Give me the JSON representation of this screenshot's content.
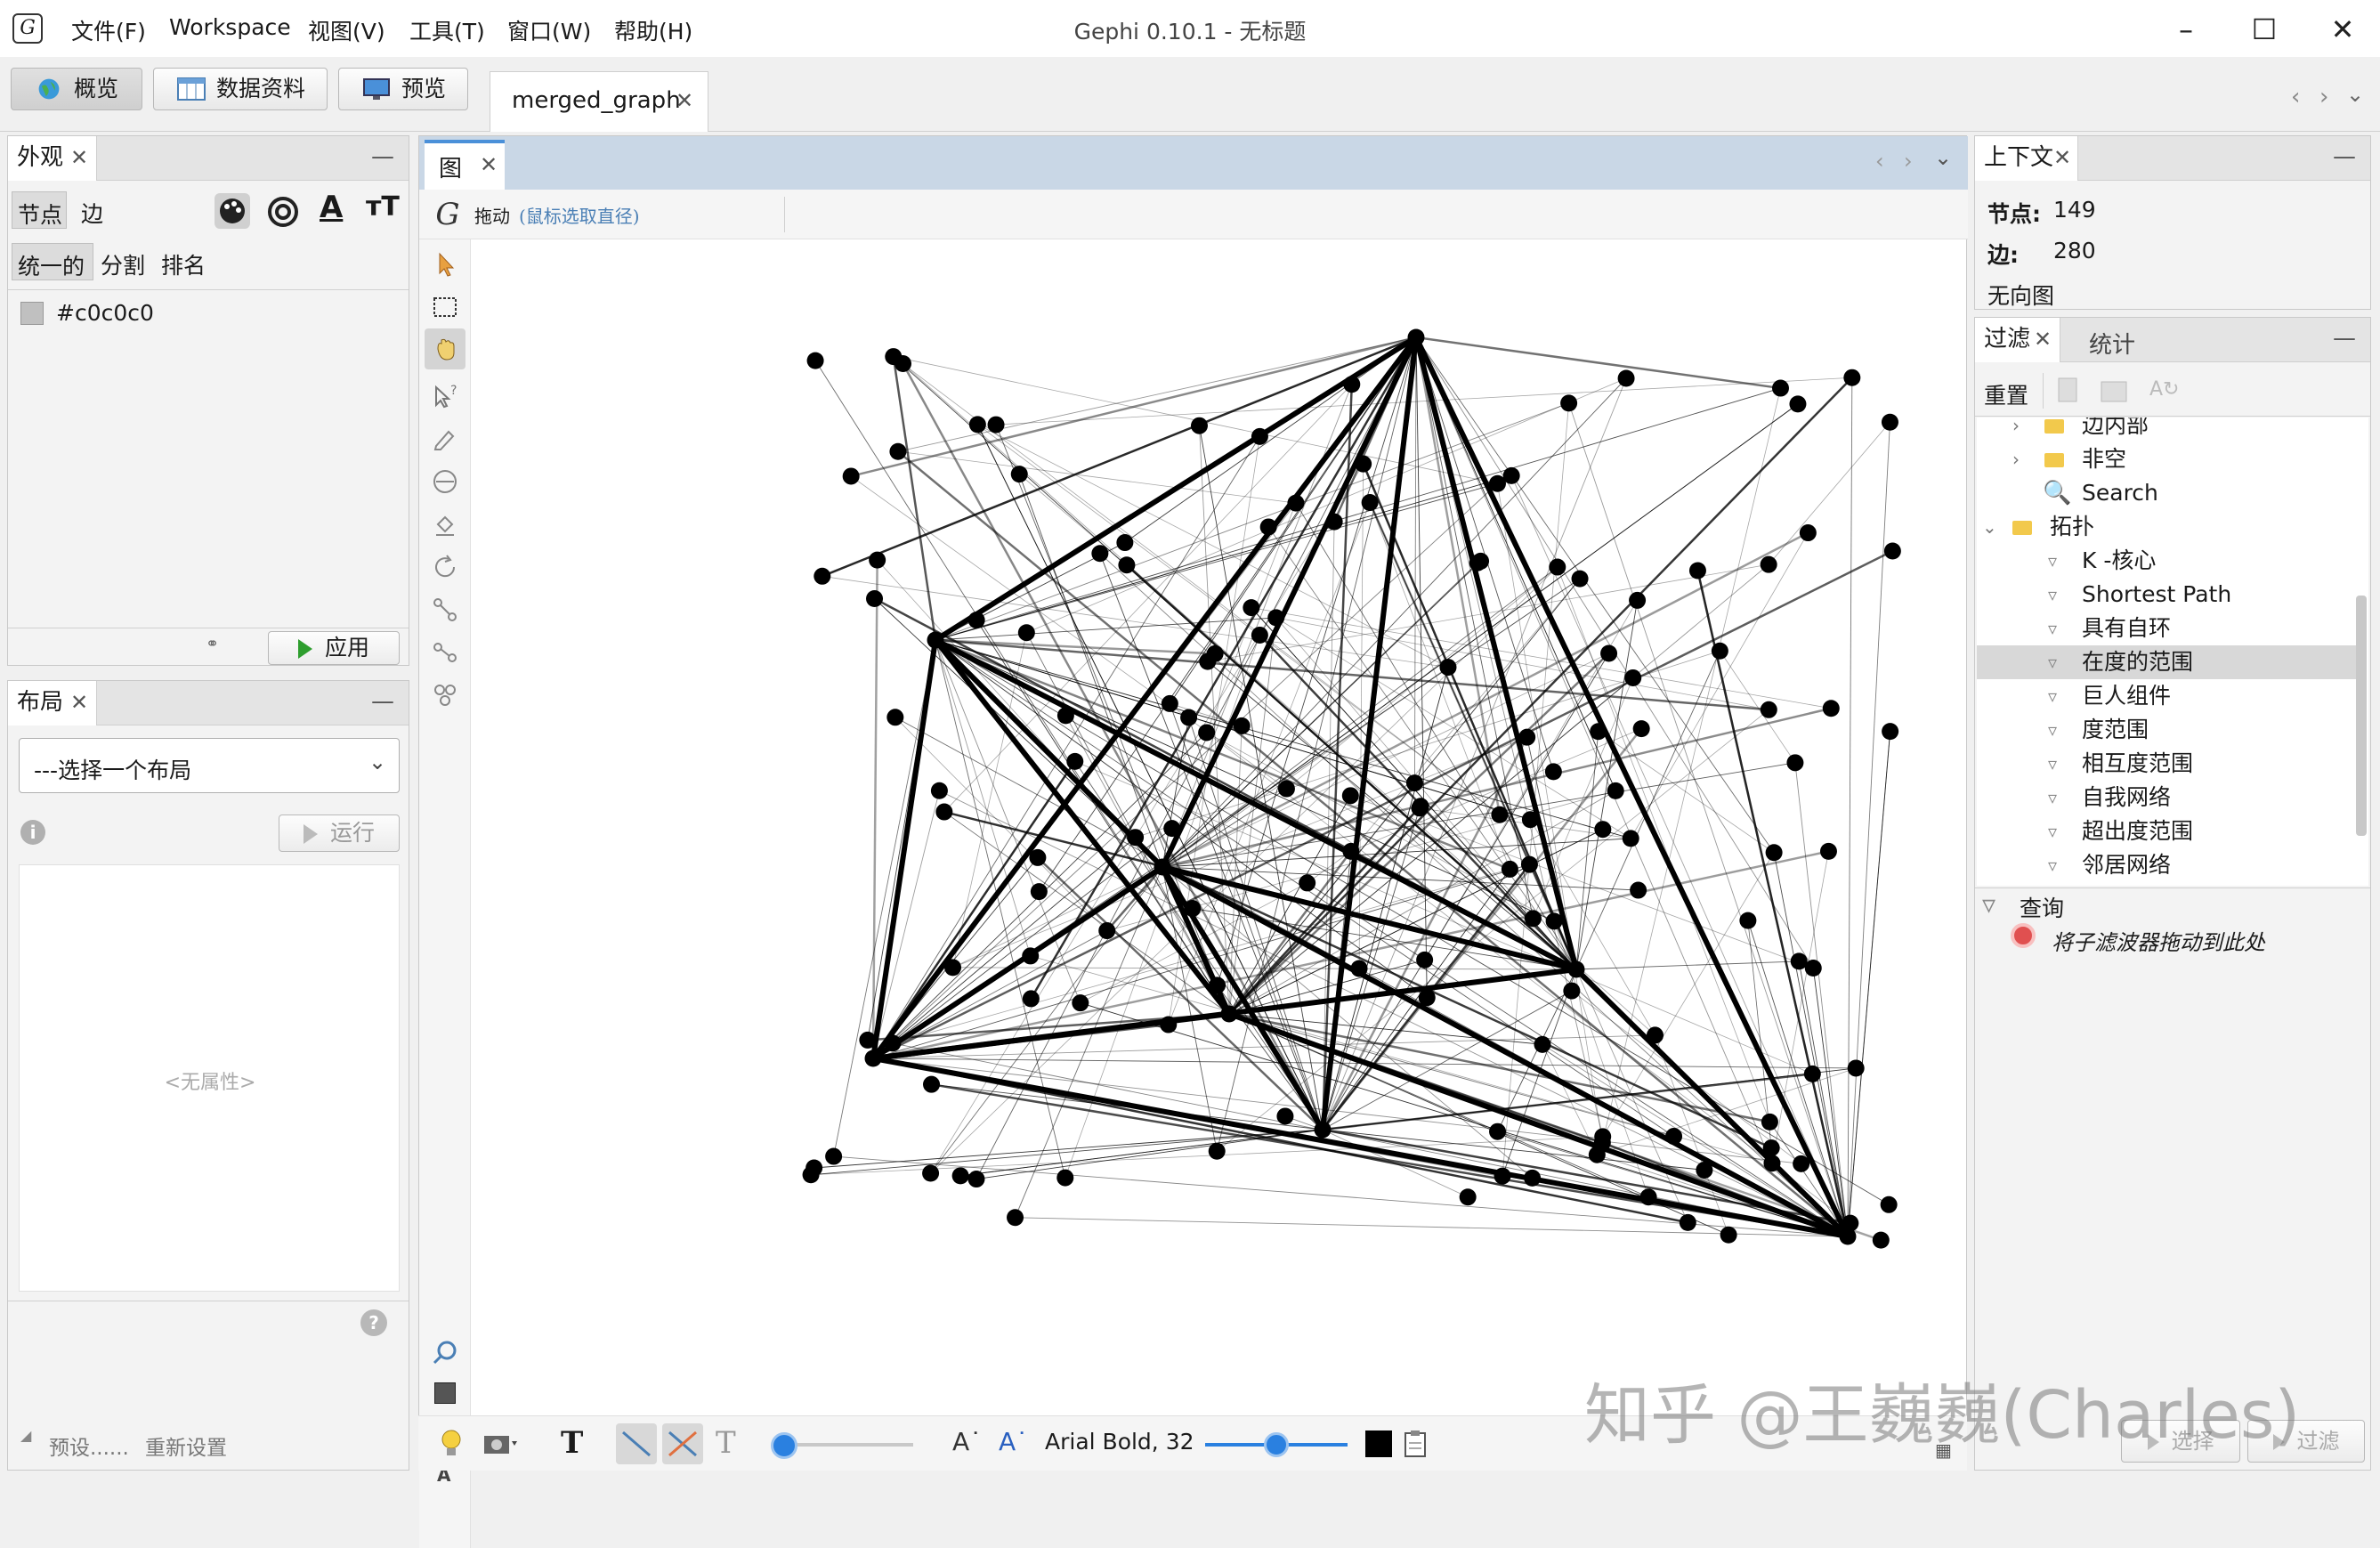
{
  "window": {
    "title": "Gephi 0.10.1 - 无标题",
    "menu": [
      "文件(F)",
      "Workspace",
      "视图(V)",
      "工具(T)",
      "窗口(W)",
      "帮助(H)"
    ]
  },
  "modes": {
    "overview": "概览",
    "data_lab": "数据资料",
    "preview": "预览"
  },
  "document_tab": "merged_graph",
  "appearance": {
    "tab": "外观",
    "subtabs": [
      "节点",
      "边"
    ],
    "modes": [
      "统一的",
      "分割",
      "排名"
    ],
    "color_value": "#c0c0c0",
    "apply": "应用"
  },
  "layout": {
    "tab": "布局",
    "select_placeholder": "---选择一个布局",
    "run": "运行",
    "no_props": "<无属性>",
    "presets": "预设......",
    "reset": "重新设置"
  },
  "graph": {
    "tab": "图",
    "tool_name": "拖动",
    "tool_hint": "(鼠标选取直径)",
    "font_label": "Arial Bold, 32"
  },
  "context": {
    "tab": "上下文",
    "nodes_label": "节点:",
    "nodes_value": "149",
    "edges_label": "边:",
    "edges_value": "280",
    "graph_type": "无向图"
  },
  "filters": {
    "tab": "过滤",
    "tab2": "统计",
    "reset": "重置",
    "tree": [
      {
        "label": "边内部",
        "kind": "folder",
        "indent": 1
      },
      {
        "label": "非空",
        "kind": "folder",
        "indent": 1
      },
      {
        "label": "Search",
        "kind": "search",
        "indent": 1
      },
      {
        "label": "拓扑",
        "kind": "folder-open",
        "indent": 0
      },
      {
        "label": "K -核心",
        "kind": "filter",
        "indent": 2
      },
      {
        "label": "Shortest Path",
        "kind": "filter",
        "indent": 2
      },
      {
        "label": "具有自环",
        "kind": "filter",
        "indent": 2
      },
      {
        "label": "在度的范围",
        "kind": "filter",
        "indent": 2,
        "selected": true
      },
      {
        "label": "巨人组件",
        "kind": "filter",
        "indent": 2
      },
      {
        "label": "度范围",
        "kind": "filter",
        "indent": 2
      },
      {
        "label": "相互度范围",
        "kind": "filter",
        "indent": 2
      },
      {
        "label": "自我网络",
        "kind": "filter",
        "indent": 2
      },
      {
        "label": "超出度范围",
        "kind": "filter",
        "indent": 2
      },
      {
        "label": "邻居网络",
        "kind": "filter",
        "indent": 2
      }
    ],
    "query_label": "查询",
    "drop_hint": "将子滤波器拖动到此处",
    "select_btn": "选择",
    "filter_btn": "过滤"
  },
  "watermark": "知乎 @王巍巍(Charles)"
}
